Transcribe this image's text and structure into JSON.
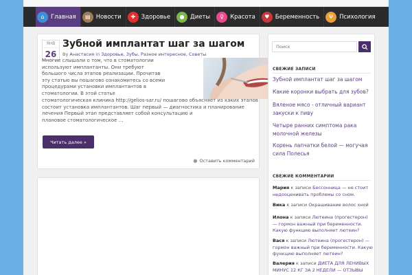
{
  "nav": {
    "items": [
      {
        "label": "Главная",
        "icon": "home-icon",
        "color": "#3d8fd8"
      },
      {
        "label": "Новости",
        "icon": "news-icon",
        "color": "#a07a55"
      },
      {
        "label": "Здоровье",
        "icon": "health-cross-icon",
        "color": "#e03030"
      },
      {
        "label": "Диеты",
        "icon": "apple-icon",
        "color": "#7ab648"
      },
      {
        "label": "Красота",
        "icon": "beauty-icon",
        "color": "#e94a8c"
      },
      {
        "label": "Беременность",
        "icon": "pregnancy-icon",
        "color": "#c83a3a"
      },
      {
        "label": "Психология",
        "icon": "psychology-icon",
        "color": "#e8a13a"
      }
    ]
  },
  "post": {
    "month": "ЯНВ",
    "day": "26",
    "title": "Зубной имплантат шаг за шагом",
    "meta_by": "By",
    "author": "Анастасия",
    "meta_in": "in",
    "categories": "Здоровье, Зубы, Разное интересное, Советы",
    "excerpt_lines": [
      "Многие слышали о том, что в стоматологии",
      "используют имплантанты. Они требуют",
      "большого числа этапов реализации. Прочитав",
      "эту статью вы пошагово ознакомитесь со всеми",
      "процедурами установки имплантантов в",
      "стоматологии. В этой статье"
    ],
    "excerpt_full_lines": [
      "стоматологическая клиника http://gelios-sar.ru/ пошагово объясняет из каких этапов",
      "состоит установка имплантантов. Шаг первый — диагностика и планирование",
      "лечения Первый этап представляет собой консультацию и",
      "плановое стоматологическое …"
    ],
    "read_more": "Читать далее »",
    "comment_link": "Оставить комментарий"
  },
  "sidebar": {
    "search_placeholder": "Поиск",
    "recent_title": "СВЕЖИЕ ЗАПИСИ",
    "recent": [
      {
        "lines": [
          "Зубной имплантат шаг за шагом"
        ]
      },
      {
        "lines": [
          "Какие коронки выбрать для зубов?"
        ]
      },
      {
        "lines": [
          "Вяленое мясо - отличный вариант",
          "закуски к пиву"
        ]
      },
      {
        "lines": [
          "Четыре ранних симптома рака",
          "молочной железы"
        ]
      },
      {
        "lines": [
          "Корень лапчатки белой — могучая",
          "сила Полесья"
        ]
      }
    ],
    "comments_title": "СВЕЖИЕ КОММЕНТАРИИ",
    "comments": [
      {
        "author": "Мария",
        "to": "к записи",
        "lines": [
          "Бессонница — не стоит",
          "недооценивать проблемы со сном."
        ]
      },
      {
        "author": "Вика",
        "to": "к записи",
        "lines": [
          "Окрашивание волос хной"
        ]
      },
      {
        "author": "Илона",
        "to": "к записи",
        "lines": [
          "Лютеина (прогестерон) —",
          "гормон важный при беременности. Какую",
          "функцию выполняет лютеин?"
        ]
      },
      {
        "author": "Вася",
        "to": "к записи",
        "lines": [
          "Лютеина (прогестерон) —",
          "гормон важный при беременности. Какую",
          "функцию выполняет лютеин?"
        ]
      },
      {
        "author": "Валерия",
        "to": "к записи",
        "lines": [
          "ДИЕТА ДЛЯ ЛЕНИВЫХ",
          "МИНУС 12 КГ ЗА 2 НЕДЕЛИ — ОТЗЫВЫ"
        ]
      }
    ]
  },
  "colors": {
    "accent": "#5b3e82",
    "nav_bg": "#2b2b2b",
    "page_bg": "#6ab0e8"
  }
}
